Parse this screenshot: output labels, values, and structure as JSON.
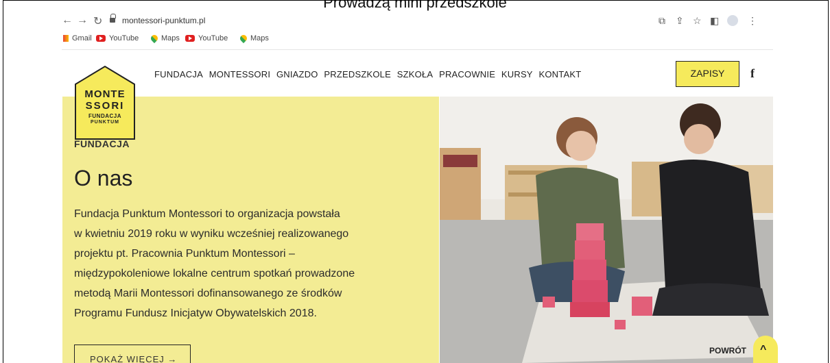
{
  "caption": "Prowadzą mini przedszkole",
  "browser": {
    "url": "montessori-punktum.pl",
    "bookmarks": [
      {
        "label": "Gmail",
        "icon": "gmail-icon"
      },
      {
        "label": "YouTube",
        "icon": "youtube-icon"
      },
      {
        "label": "Maps",
        "icon": "maps-icon"
      },
      {
        "label": "YouTube",
        "icon": "youtube-icon"
      },
      {
        "label": "Maps",
        "icon": "maps-icon"
      }
    ],
    "icons": [
      "back-icon",
      "forward-icon",
      "reload-icon",
      "lock-icon",
      "translate-icon",
      "share-icon",
      "star-icon",
      "sidepanel-icon",
      "profile-icon",
      "more-icon"
    ]
  },
  "site": {
    "logo": {
      "line1": "MONTE",
      "line2": "SSORI",
      "line3": "FUNDACJA",
      "line4": "PUNKTUM"
    },
    "menu": [
      "FUNDACJA",
      "MONTESSORI",
      "GNIAZDO",
      "PRZEDSZKOLE",
      "SZKOŁA",
      "PRACOWNIE",
      "KURSY",
      "KONTAKT"
    ],
    "cta_label": "ZAPISY",
    "social_icon": "facebook-icon",
    "social_glyph": "f"
  },
  "hero": {
    "kicker": "FUNDACJA",
    "title": "O nas",
    "body_lines": [
      "Fundacja Punktum Montessori to organizacja powstała",
      "w kwietniu 2019 roku w wyniku wcześniej realizowanego",
      "projektu pt. Pracownia Punktum Montessori –",
      "międzypokoleniowe lokalne centrum spotkań prowadzone",
      "metodą Marii Montessori dofinansowanego ze środków",
      "Programu Fundusz Inicjatyw Obywatelskich 2018."
    ],
    "more_label": "POKAŻ WIĘCEJ →",
    "back_label": "POWRÓT",
    "back_glyph": "^"
  },
  "colors": {
    "accent": "#f6ea5c",
    "hero_bg": "#f3ec94"
  }
}
